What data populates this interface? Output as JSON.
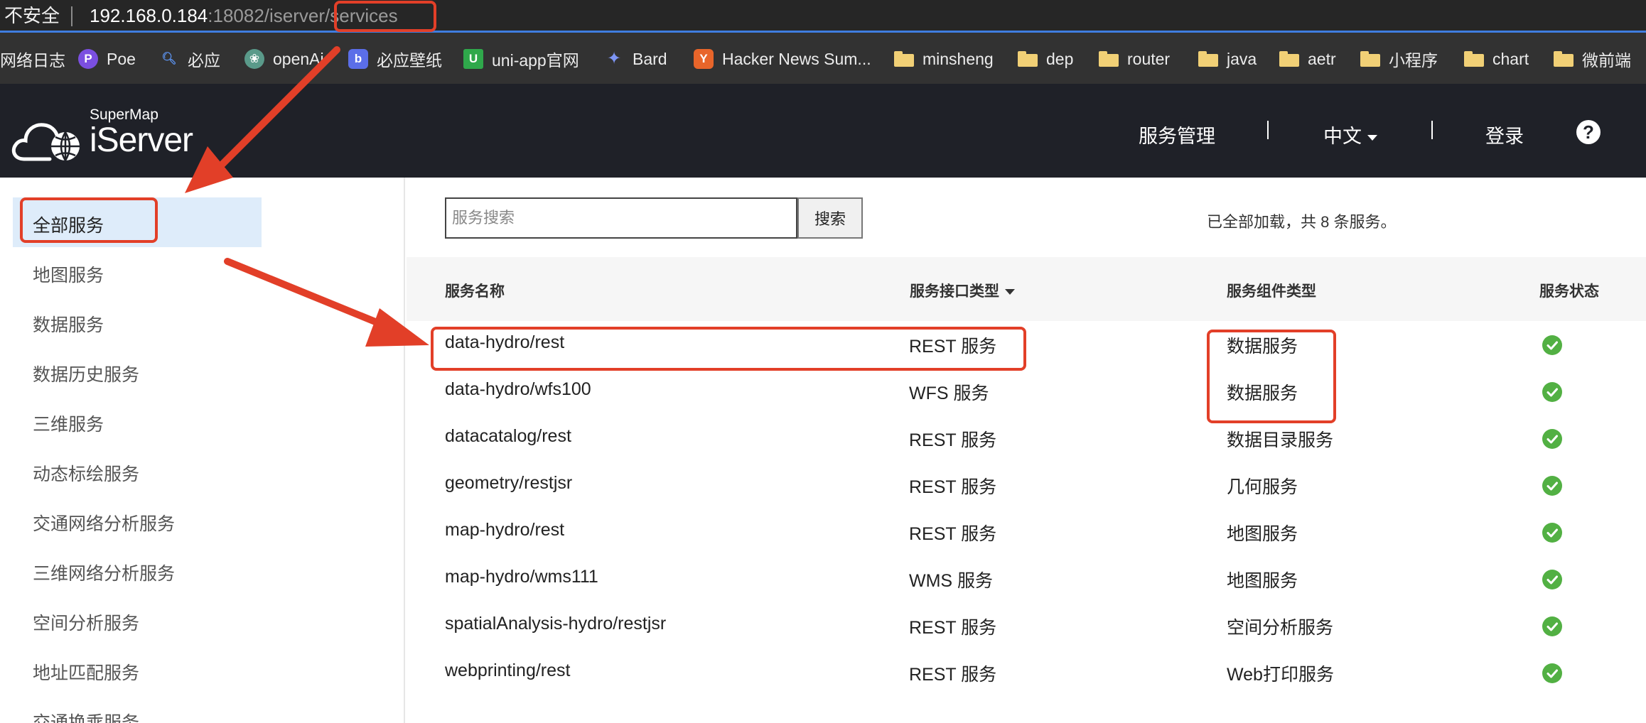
{
  "browser": {
    "insecure_label": "不安全",
    "url_host": "192.168.0.184",
    "url_path": ":18082/iserver",
    "url_highlight": "/services",
    "bookmarks": [
      {
        "label": "网络日志",
        "icon": "none"
      },
      {
        "label": "Poe",
        "icon": "poe-icon",
        "color": "#7b4fe0"
      },
      {
        "label": "必应",
        "icon": "search-icon",
        "color": "#3a6fd6"
      },
      {
        "label": "openAi",
        "icon": "openai-icon",
        "color": "#5a9a8a"
      },
      {
        "label": "必应壁纸",
        "icon": "wallpaper-icon",
        "color": "#5b6ee8"
      },
      {
        "label": "uni-app官网",
        "icon": "uniapp-icon",
        "color": "#2fa84b"
      },
      {
        "label": "Bard",
        "icon": "sparkle-icon",
        "color": "#6f8ff3"
      },
      {
        "label": "Hacker News Sum...",
        "icon": "hn-icon",
        "color": "#e8652a"
      },
      {
        "label": "minsheng",
        "icon": "folder-icon"
      },
      {
        "label": "dep",
        "icon": "folder-icon"
      },
      {
        "label": "router",
        "icon": "folder-icon"
      },
      {
        "label": "java",
        "icon": "folder-icon"
      },
      {
        "label": "aetr",
        "icon": "folder-icon"
      },
      {
        "label": "小程序",
        "icon": "folder-icon"
      },
      {
        "label": "chart",
        "icon": "folder-icon"
      },
      {
        "label": "微前端",
        "icon": "folder-icon"
      }
    ]
  },
  "header": {
    "brand_small": "SuperMap",
    "brand_big": "iServer",
    "nav_service_mgmt": "服务管理",
    "nav_language": "中文",
    "nav_login": "登录",
    "help_icon": "?"
  },
  "sidebar": {
    "items": [
      {
        "label": "全部服务",
        "active": true
      },
      {
        "label": "地图服务"
      },
      {
        "label": "数据服务"
      },
      {
        "label": "数据历史服务"
      },
      {
        "label": "三维服务"
      },
      {
        "label": "动态标绘服务"
      },
      {
        "label": "交通网络分析服务"
      },
      {
        "label": "三维网络分析服务"
      },
      {
        "label": "空间分析服务"
      },
      {
        "label": "地址匹配服务"
      },
      {
        "label": "交通换乘服务"
      }
    ]
  },
  "search": {
    "placeholder": "服务搜索",
    "button_label": "搜索",
    "status_text": "已全部加载，共 8 条服务。"
  },
  "table": {
    "headers": {
      "name": "服务名称",
      "interface": "服务接口类型",
      "component": "服务组件类型",
      "status": "服务状态"
    },
    "rows": [
      {
        "name": "data-hydro/rest",
        "interface": "REST 服务",
        "component": "数据服务",
        "status": "ok"
      },
      {
        "name": "data-hydro/wfs100",
        "interface": "WFS 服务",
        "component": "数据服务",
        "status": "ok"
      },
      {
        "name": "datacatalog/rest",
        "interface": "REST 服务",
        "component": "数据目录服务",
        "status": "ok"
      },
      {
        "name": "geometry/restjsr",
        "interface": "REST 服务",
        "component": "几何服务",
        "status": "ok"
      },
      {
        "name": "map-hydro/rest",
        "interface": "REST 服务",
        "component": "地图服务",
        "status": "ok"
      },
      {
        "name": "map-hydro/wms111",
        "interface": "WMS 服务",
        "component": "地图服务",
        "status": "ok"
      },
      {
        "name": "spatialAnalysis-hydro/restjsr",
        "interface": "REST 服务",
        "component": "空间分析服务",
        "status": "ok"
      },
      {
        "name": "webprinting/rest",
        "interface": "REST 服务",
        "component": "Web打印服务",
        "status": "ok"
      }
    ]
  },
  "colors": {
    "annotation_red": "#e23f28",
    "header_bg": "#1f2128",
    "status_ok": "#52b043",
    "active_bg": "#deecfa"
  }
}
